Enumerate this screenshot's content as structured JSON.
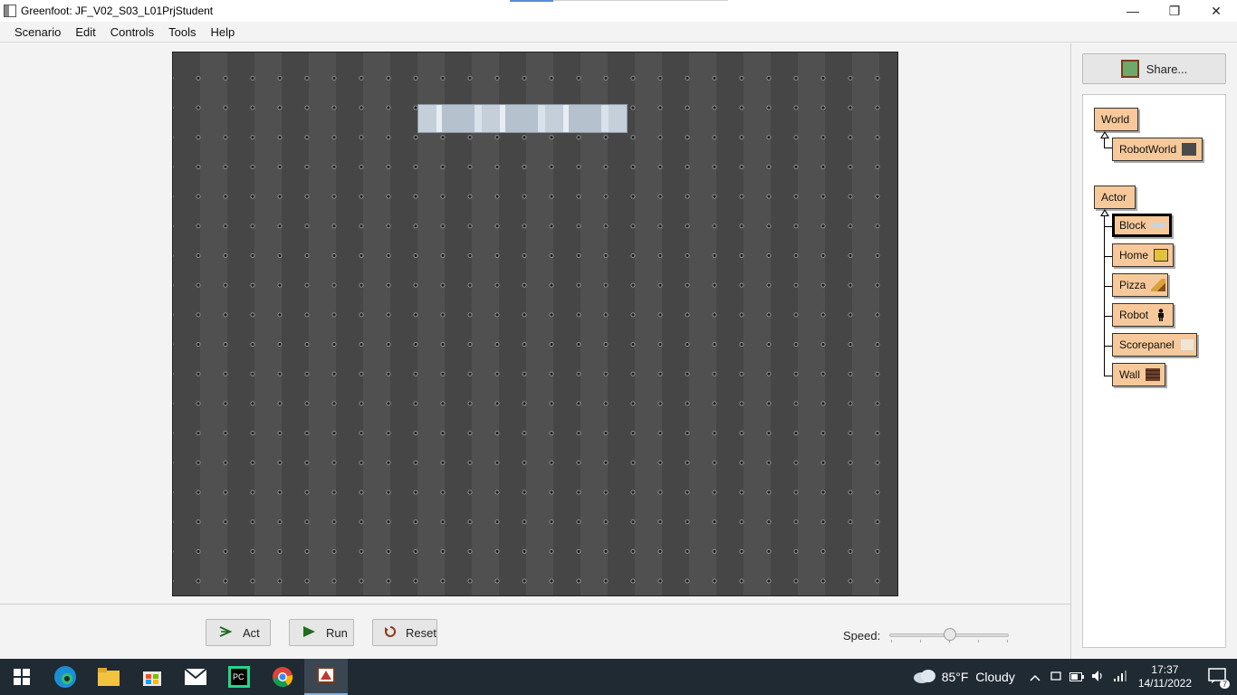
{
  "window": {
    "title": "Greenfoot: JF_V02_S03_L01PrjStudent",
    "minimize": "—",
    "maximize": "❐",
    "close": "✕"
  },
  "menu": [
    "Scenario",
    "Edit",
    "Controls",
    "Tools",
    "Help"
  ],
  "controls": {
    "act": "Act",
    "run": "Run",
    "reset": "Reset",
    "speed_label": "Speed:",
    "speed_value": 0.5
  },
  "share": {
    "label": "Share..."
  },
  "classes": {
    "world_root": "World",
    "world_sub": [
      "RobotWorld"
    ],
    "actor_root": "Actor",
    "actor_subs": [
      "Block",
      "Home",
      "Pizza",
      "Robot",
      "Scorepanel",
      "Wall"
    ],
    "selected": "Block"
  },
  "taskbar": {
    "weather": "85°F  Cloudy",
    "time": "17:37",
    "date": "14/11/2022",
    "notifications": "7"
  }
}
